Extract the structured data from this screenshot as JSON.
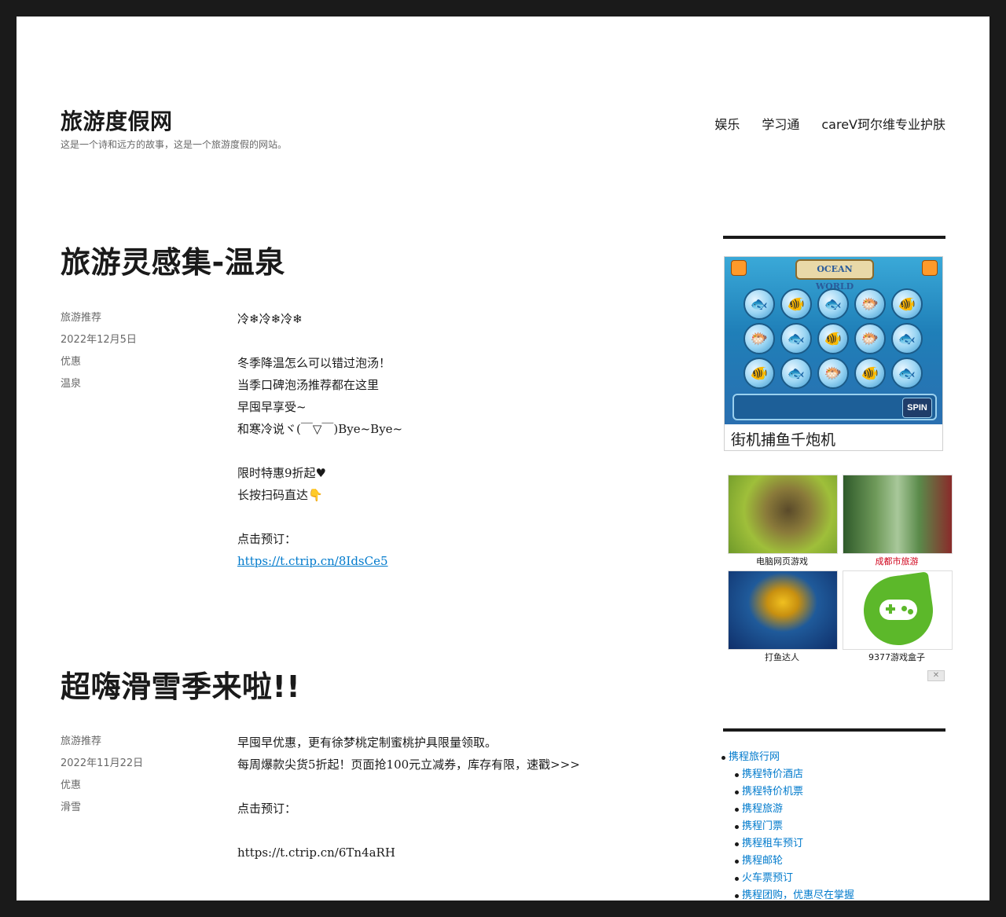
{
  "site": {
    "title": "旅游度假网",
    "description": "这是一个诗和远方的故事，这是一个旅游度假的网站。"
  },
  "nav": {
    "items": [
      "娱乐",
      "学习通",
      "careV珂尔维专业护肤"
    ]
  },
  "posts": [
    {
      "title": "旅游灵感集-温泉",
      "meta": {
        "category": "旅游推荐",
        "date": "2022年12月5日",
        "tag1": "优惠",
        "tag2": "温泉"
      },
      "lines": [
        "冷❄冷❄冷❄",
        "",
        "冬季降温怎么可以错过泡汤！",
        "当季口碑泡汤推荐都在这里",
        "早囤早享受~",
        "和寒冷说ヾ(￣▽￣)Bye~Bye~",
        "",
        "限时特惠9折起♥",
        "长按扫码直达👇",
        "",
        "点击预订："
      ],
      "link": "https://t.ctrip.cn/8IdsCe5"
    },
    {
      "title": "超嗨滑雪季来啦!!",
      "meta": {
        "category": "旅游推荐",
        "date": "2022年11月22日",
        "tag1": "优惠",
        "tag2": "滑雪"
      },
      "lines": [
        "早囤早优惠，更有徐梦桃定制蜜桃护具限量领取。",
        "每周爆款尖货5折起！页面抢100元立减券，库存有限，速戳>>>",
        "",
        "点击预订：",
        "",
        "https://t.ctrip.cn/6Tn4aRH"
      ]
    }
  ],
  "sidebar": {
    "ad_big": {
      "banner": "OCEAN WORLD",
      "spin": "SPIN",
      "caption": "街机捕鱼千炮机"
    },
    "ad_tiles": [
      {
        "label": "电脑网页游戏",
        "icon": "strategy-game-icon"
      },
      {
        "label": "成都市旅游",
        "icon": "bamboo-forest-icon"
      },
      {
        "label": "打鱼达人",
        "icon": "golden-fish-icon"
      },
      {
        "label": "9377游戏盒子",
        "icon": "gamepad-leaf-icon"
      }
    ],
    "ad_close": "✕",
    "links": {
      "top": "携程旅行网",
      "sub": [
        "携程特价酒店",
        "携程特价机票",
        "携程旅游",
        "携程门票",
        "携程租车预订",
        "携程邮轮",
        "火车票预订",
        "携程团购，优惠尽在掌握"
      ]
    }
  },
  "colors": {
    "link": "#007acc",
    "text": "#1a1a1a",
    "meta": "#686868",
    "frame": "#1a1a1a"
  }
}
